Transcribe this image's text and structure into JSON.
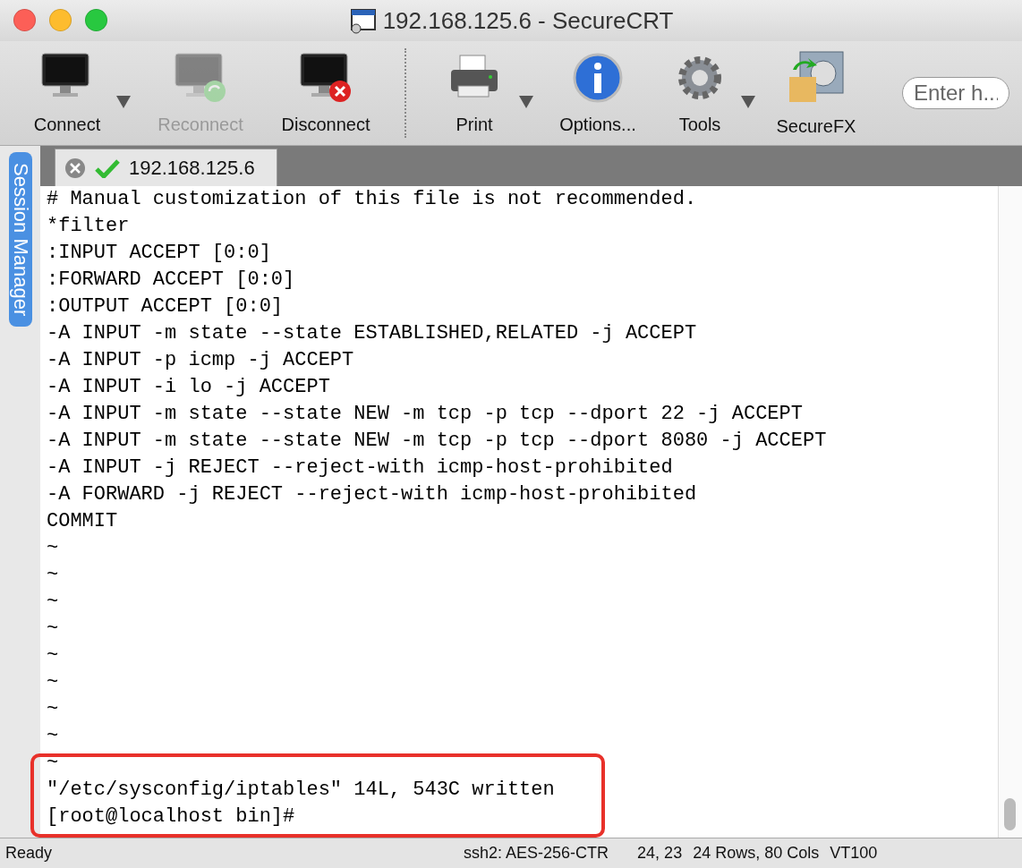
{
  "window": {
    "title": "192.168.125.6 - SecureCRT"
  },
  "toolbar": {
    "items": [
      {
        "label": "Connect",
        "disabled": false,
        "dropdown": true
      },
      {
        "label": "Reconnect",
        "disabled": true,
        "dropdown": false
      },
      {
        "label": "Disconnect",
        "disabled": false,
        "dropdown": false
      },
      {
        "label": "Print",
        "disabled": false,
        "dropdown": true
      },
      {
        "label": "Options...",
        "disabled": false,
        "dropdown": false
      },
      {
        "label": "Tools",
        "disabled": false,
        "dropdown": true
      },
      {
        "label": "SecureFX",
        "disabled": false,
        "dropdown": false
      }
    ],
    "search": {
      "placeholder": "Enter h..."
    }
  },
  "session_manager": {
    "label": "Session Manager"
  },
  "tabs": [
    {
      "label": "192.168.125.6",
      "selected": true,
      "connected": true
    }
  ],
  "terminal": {
    "lines": [
      "# Manual customization of this file is not recommended.",
      "*filter",
      ":INPUT ACCEPT [0:0]",
      ":FORWARD ACCEPT [0:0]",
      ":OUTPUT ACCEPT [0:0]",
      "-A INPUT -m state --state ESTABLISHED,RELATED -j ACCEPT",
      "-A INPUT -p icmp -j ACCEPT",
      "-A INPUT -i lo -j ACCEPT",
      "-A INPUT -m state --state NEW -m tcp -p tcp --dport 22 -j ACCEPT",
      "-A INPUT -m state --state NEW -m tcp -p tcp --dport 8080 -j ACCEPT",
      "-A INPUT -j REJECT --reject-with icmp-host-prohibited",
      "-A FORWARD -j REJECT --reject-with icmp-host-prohibited",
      "COMMIT",
      "~",
      "~",
      "~",
      "~",
      "~",
      "~",
      "~",
      "~",
      "~"
    ],
    "highlighted_lines": [
      "\"/etc/sysconfig/iptables\" 14L, 543C written",
      "[root@localhost bin]#"
    ]
  },
  "status_bar": {
    "status": "Ready",
    "cipher": "ssh2: AES-256-CTR",
    "cursor": "24, 23",
    "size": "24 Rows, 80 Cols",
    "emulation": "VT100"
  }
}
